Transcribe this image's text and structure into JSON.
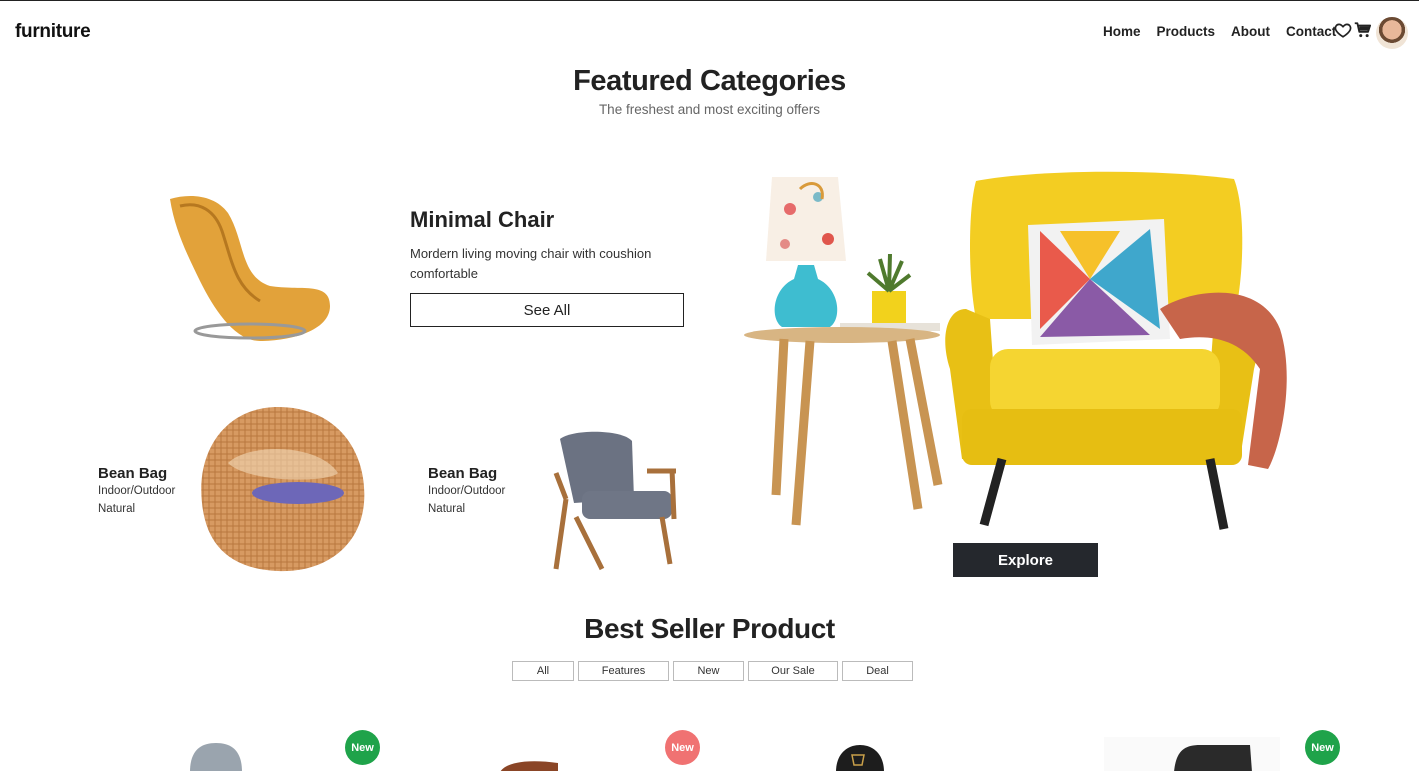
{
  "header": {
    "logo": "furniture",
    "nav": [
      "Home",
      "Products",
      "About",
      "Contact"
    ],
    "icons": [
      "heart-icon",
      "cart-icon",
      "avatar"
    ]
  },
  "featured": {
    "title": "Featured Categories",
    "subtitle": "The freshest and most exciting offers",
    "minimal_chair": {
      "title": "Minimal Chair",
      "description": "Mordern living moving chair with coushion comfortable",
      "button": "See All"
    },
    "bean_bags": [
      {
        "name": "Bean Bag",
        "line1": "Indoor/Outdoor",
        "line2": "Natural"
      },
      {
        "name": "Bean Bag",
        "line1": "Indoor/Outdoor",
        "line2": "Natural"
      }
    ],
    "explore_button": "Explore"
  },
  "best_seller": {
    "title": "Best Seller Product",
    "tabs": [
      "All",
      "Features",
      "New",
      "Our Sale",
      "Deal"
    ],
    "badges": [
      {
        "label": "New",
        "color": "#1fa34a"
      },
      {
        "label": "New",
        "color": "#f07272"
      },
      {
        "label": "New",
        "color": "#1fa34a"
      }
    ]
  },
  "colors": {
    "dark_button": "#25282d",
    "accent_yellow": "#f2cf1f",
    "badge_green": "#1fa34a",
    "badge_red": "#f07272"
  }
}
